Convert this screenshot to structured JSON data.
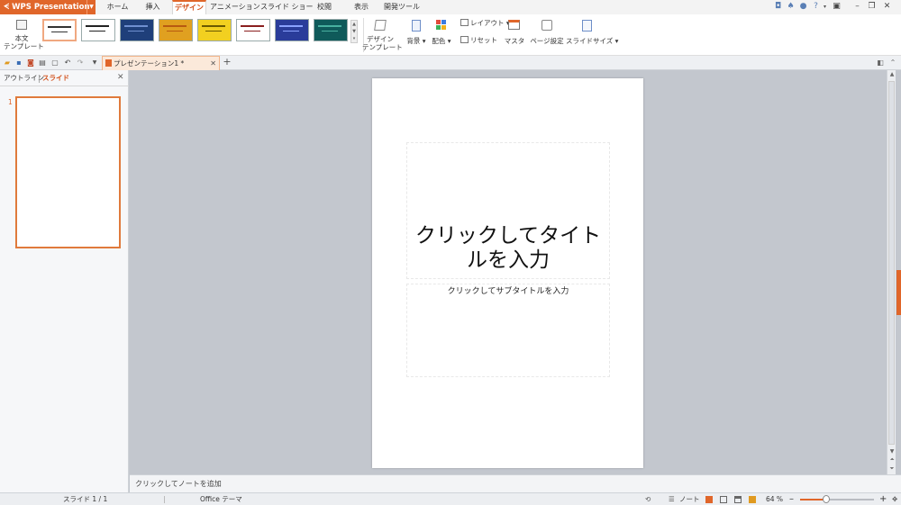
{
  "app": {
    "name": "WPS Presentation"
  },
  "menu": {
    "tabs": [
      "ホーム",
      "挿入",
      "デザイン",
      "アニメーション",
      "スライド ショー",
      "校閲",
      "表示",
      "開発ツール"
    ],
    "active_tab": "デザイン"
  },
  "ribbon": {
    "body_template": [
      "本文",
      "テンプレート"
    ],
    "design_template": [
      "デザイン",
      "テンプレート"
    ],
    "background": "背景",
    "color_scheme": "配色",
    "layout": "レイアウト",
    "reset": "リセット",
    "master": "マスタ",
    "page_setup": "ページ設定",
    "slide_size": "スライドサイズ"
  },
  "document": {
    "tab_title": "プレゼンテーション1 *"
  },
  "left_pane": {
    "tab_outline": "アウトライン",
    "tab_slides": "スライド",
    "slide_number": "1"
  },
  "slide": {
    "title_placeholder": "クリックしてタイトルを入力",
    "subtitle_placeholder": "クリックしてサブタイトルを入力"
  },
  "notes": {
    "placeholder": "クリックしてノートを追加"
  },
  "status": {
    "slide_info": "スライド 1 / 1",
    "theme": "Office テーマ",
    "notes_label": "ノート",
    "zoom": "64 %",
    "zoom_fraction": 0.35
  },
  "theme_thumbs": [
    {
      "bg": "#ffffff",
      "accent": "#333333"
    },
    {
      "bg": "#ffffff",
      "accent": "#222222"
    },
    {
      "bg": "#1f3f7a",
      "accent": "#6f8fd0"
    },
    {
      "bg": "#e0a020",
      "accent": "#b85a10"
    },
    {
      "bg": "#f2d020",
      "accent": "#6b5a00"
    },
    {
      "bg": "#ffffff",
      "accent": "#8a1f1f"
    },
    {
      "bg": "#2a3c9a",
      "accent": "#8aa2ff"
    },
    {
      "bg": "#0f5a5a",
      "accent": "#48b0a0"
    }
  ],
  "colors": {
    "accent": "#e0662a"
  }
}
